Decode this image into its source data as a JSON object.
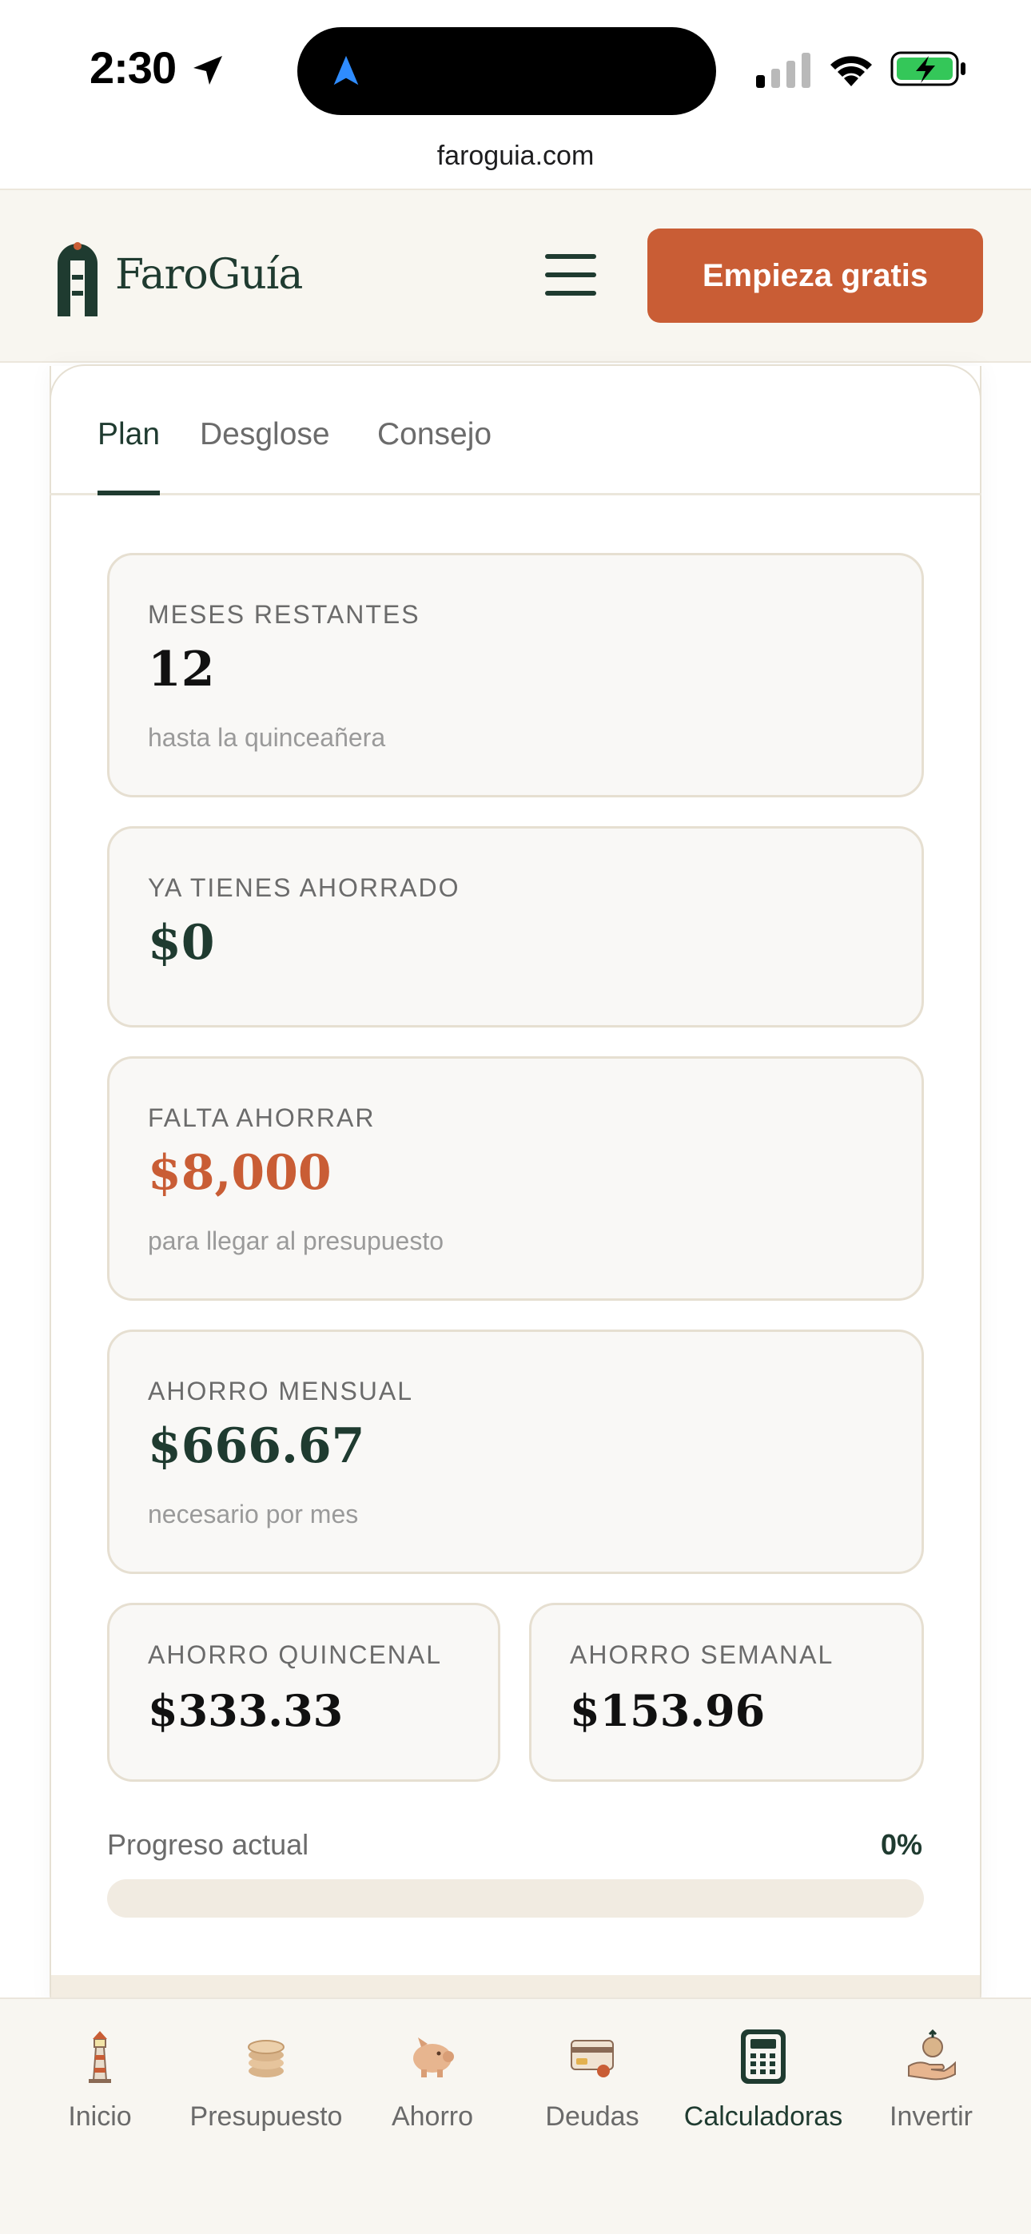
{
  "status_bar": {
    "time": "2:30"
  },
  "browser": {
    "url": "faroguia.com"
  },
  "header": {
    "logo_text": "FaroGuía",
    "cta_label": "Empieza gratis"
  },
  "tabs": [
    {
      "label": "Plan",
      "active": true
    },
    {
      "label": "Desglose",
      "active": false
    },
    {
      "label": "Consejo",
      "active": false
    }
  ],
  "stats": {
    "months": {
      "label": "MESES RESTANTES",
      "value": "12",
      "sub": "hasta la quinceañera"
    },
    "saved": {
      "label": "YA TIENES AHORRADO",
      "value": "$0"
    },
    "remaining": {
      "label": "FALTA AHORRAR",
      "value": "$8,000",
      "sub": "para llegar al presupuesto"
    },
    "monthly": {
      "label": "AHORRO MENSUAL",
      "value": "$666.67",
      "sub": "necesario por mes"
    },
    "biweekly": {
      "label": "AHORRO QUINCENAL",
      "value": "$333.33"
    },
    "weekly": {
      "label": "AHORRO SEMANAL",
      "value": "$153.96"
    }
  },
  "progress": {
    "label": "Progreso actual",
    "percent_text": "0%",
    "value": 0
  },
  "bottom_nav": [
    {
      "label": "Inicio",
      "icon": "lighthouse-icon",
      "active": false
    },
    {
      "label": "Presupuesto",
      "icon": "coins-icon",
      "active": false
    },
    {
      "label": "Ahorro",
      "icon": "piggy-bank-icon",
      "active": false
    },
    {
      "label": "Deudas",
      "icon": "credit-card-icon",
      "active": false
    },
    {
      "label": "Calculadoras",
      "icon": "calculator-icon",
      "active": true
    },
    {
      "label": "Invertir",
      "icon": "investment-hand-icon",
      "active": false
    }
  ],
  "colors": {
    "brand_green": "#1f3b30",
    "accent_orange": "#c95d35",
    "cream": "#f8f6f0"
  }
}
